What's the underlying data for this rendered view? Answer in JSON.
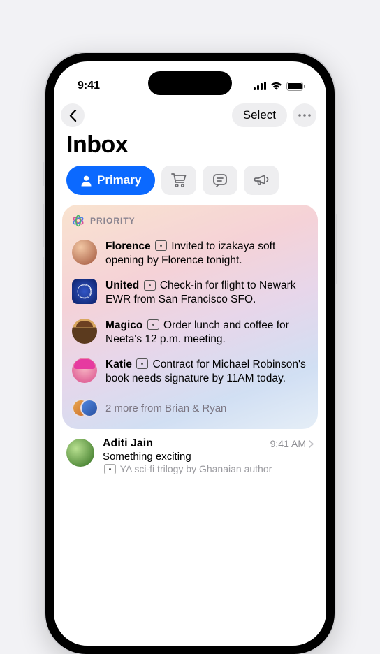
{
  "statusbar": {
    "time": "9:41"
  },
  "nav": {
    "select": "Select"
  },
  "title": "Inbox",
  "filters": {
    "primary": "Primary"
  },
  "priority": {
    "label": "PRIORITY",
    "items": [
      {
        "sender": "Florence",
        "summary": "Invited to izakaya soft opening by Florence tonight."
      },
      {
        "sender": "United",
        "summary": "Check-in for flight to Newark EWR from San Francisco SFO."
      },
      {
        "sender": "Magico",
        "summary": "Order lunch and coffee for Neeta's 12 p.m. meeting."
      },
      {
        "sender": "Katie",
        "summary": "Contract for Michael Robinson's book needs signature by 11AM today."
      }
    ],
    "more": "2 more from Brian & Ryan"
  },
  "emails": [
    {
      "sender": "Aditi Jain",
      "time": "9:41 AM",
      "subject": "Something exciting",
      "preview": "YA sci-fi trilogy by Ghanaian author"
    }
  ]
}
